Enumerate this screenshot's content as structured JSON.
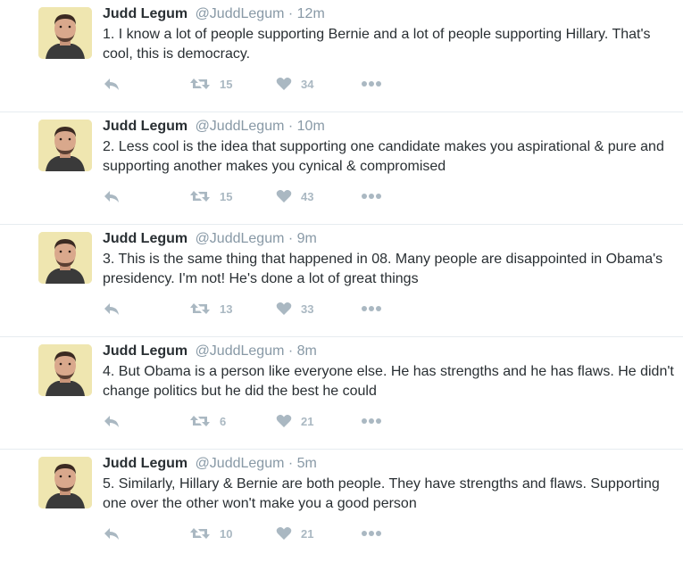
{
  "tweets": [
    {
      "name": "Judd Legum",
      "handle": "@JuddLegum",
      "separator": "·",
      "time": "12m",
      "text": "1. I know a lot of people supporting Bernie and a lot of people supporting Hillary. That's cool, this is democracy.",
      "retweets": "15",
      "likes": "34"
    },
    {
      "name": "Judd Legum",
      "handle": "@JuddLegum",
      "separator": "·",
      "time": "10m",
      "text": "2. Less cool is the idea that supporting one candidate makes you aspirational & pure and supporting another makes you cynical & compromised",
      "retweets": "15",
      "likes": "43"
    },
    {
      "name": "Judd Legum",
      "handle": "@JuddLegum",
      "separator": "·",
      "time": "9m",
      "text": "3. This is the same thing that happened in 08. Many people are disappointed in Obama's presidency. I'm not! He's done a lot of great things",
      "retweets": "13",
      "likes": "33"
    },
    {
      "name": "Judd Legum",
      "handle": "@JuddLegum",
      "separator": "·",
      "time": "8m",
      "text": "4. But Obama is a person like everyone else. He has strengths and he has flaws. He didn't change politics but he did the best he could",
      "retweets": "6",
      "likes": "21"
    },
    {
      "name": "Judd Legum",
      "handle": "@JuddLegum",
      "separator": "·",
      "time": "5m",
      "text": "5. Similarly, Hillary & Bernie are both people. They have strengths and flaws. Supporting one over the other won't make you a good person",
      "retweets": "10",
      "likes": "21"
    }
  ],
  "icons": {
    "reply": "reply-icon",
    "retweet": "retweet-icon",
    "like": "heart-icon",
    "more": "more-icon",
    "avatar": "avatar"
  },
  "colors": {
    "text": "#292f33",
    "secondary": "#8899a6",
    "action_icon": "#aab8c2",
    "divider": "#e6ecf0",
    "avatar_bg": "#efe7b3"
  }
}
